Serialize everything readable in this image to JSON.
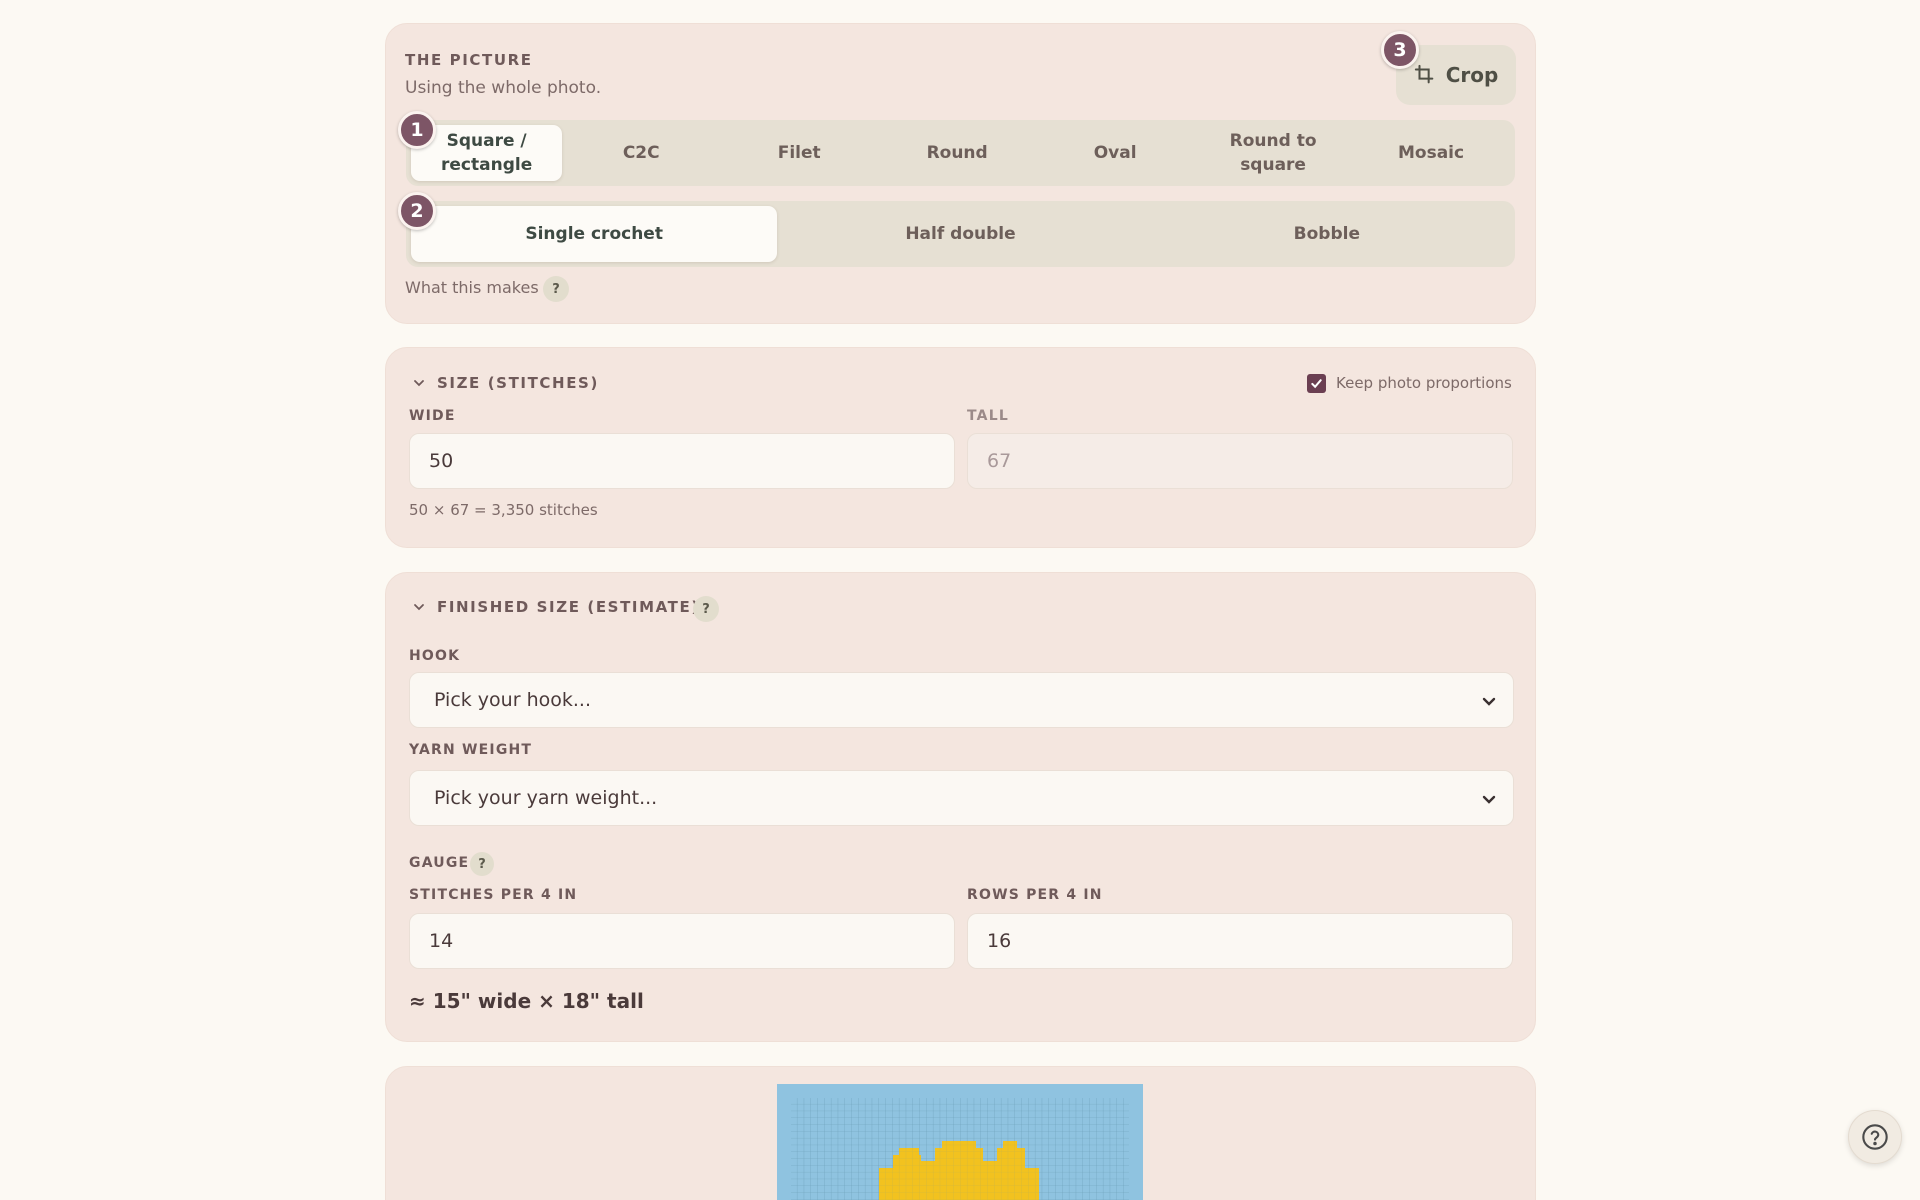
{
  "picture": {
    "section_title": "THE PICTURE",
    "subtitle": "Using the whole photo.",
    "crop_label": "Crop",
    "step_badges": [
      "1",
      "2",
      "3"
    ],
    "shape_tabs": [
      {
        "label": "Square / rectangle",
        "active": true
      },
      {
        "label": "C2C",
        "active": false
      },
      {
        "label": "Filet",
        "active": false
      },
      {
        "label": "Round",
        "active": false
      },
      {
        "label": "Oval",
        "active": false
      },
      {
        "label": "Round to square",
        "active": false
      },
      {
        "label": "Mosaic",
        "active": false
      }
    ],
    "stitch_tabs": [
      {
        "label": "Single crochet",
        "active": true
      },
      {
        "label": "Half double",
        "active": false
      },
      {
        "label": "Bobble",
        "active": false
      }
    ],
    "what_this_makes": "What this makes",
    "help_glyph": "?"
  },
  "size": {
    "section_title": "SIZE (STITCHES)",
    "keep_proportions_label": "Keep photo proportions",
    "keep_proportions_checked": true,
    "wide_label": "WIDE",
    "wide_value": "50",
    "tall_label": "TALL",
    "tall_value": "67",
    "summary": "50 × 67 = 3,350 stitches"
  },
  "finished": {
    "section_title": "FINISHED SIZE (ESTIMATE)",
    "help_glyph": "?",
    "hook_label": "HOOK",
    "hook_placeholder": "Pick your hook...",
    "yarn_label": "YARN WEIGHT",
    "yarn_placeholder": "Pick your yarn weight...",
    "gauge_label": "GAUGE",
    "gauge_help_glyph": "?",
    "stitches_label": "STITCHES PER 4 IN",
    "stitches_value": "14",
    "rows_label": "ROWS PER 4 IN",
    "rows_value": "16",
    "estimate": "≈ 15\" wide × 18\" tall"
  },
  "colors": {
    "accent": "#7d5566",
    "card_bg": "#f4e6df",
    "page_bg": "#fcf9f3",
    "preview_sky": "#8fc3e0",
    "preview_flower": "#f2c21f"
  },
  "icons": {
    "crop": "crop-icon",
    "help_fab": "help-circle-icon",
    "collapse": "chevron-down-icon"
  }
}
